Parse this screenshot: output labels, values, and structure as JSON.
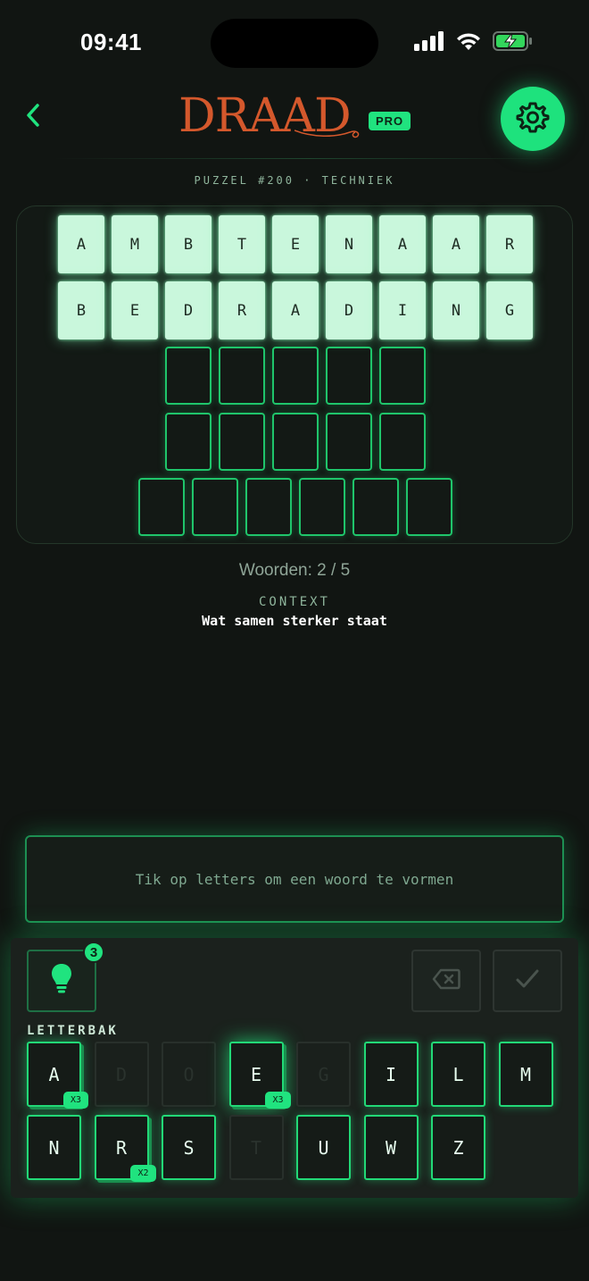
{
  "status": {
    "time": "09:41"
  },
  "header": {
    "logo": "DRAAD",
    "badge": "PRO"
  },
  "puzzle": {
    "label": "PUZZEL #200 · TECHNIEK"
  },
  "board": {
    "word1": [
      "A",
      "M",
      "B",
      "T",
      "E",
      "N",
      "A",
      "A",
      "R"
    ],
    "word2": [
      "B",
      "E",
      "D",
      "R",
      "A",
      "D",
      "I",
      "N",
      "G"
    ],
    "row3_length": 5,
    "row4_length": 5,
    "row5_length": 6
  },
  "progress": {
    "words": "Woorden: 2 / 5"
  },
  "context": {
    "label": "CONTEXT",
    "text": "Wat samen sterker staat"
  },
  "input": {
    "placeholder": "Tik op letters om een woord te vormen"
  },
  "panel": {
    "hint_count": "3",
    "letterbak_label": "LETTERBAK",
    "keys": [
      {
        "letter": "A",
        "mult": "X3",
        "used": false
      },
      {
        "letter": "D",
        "mult": "",
        "used": true
      },
      {
        "letter": "O",
        "mult": "",
        "used": true
      },
      {
        "letter": "E",
        "mult": "X3",
        "used": false
      },
      {
        "letter": "G",
        "mult": "",
        "used": true
      },
      {
        "letter": "I",
        "mult": "",
        "used": false
      },
      {
        "letter": "L",
        "mult": "",
        "used": false
      },
      {
        "letter": "M",
        "mult": "",
        "used": false
      },
      {
        "letter": "N",
        "mult": "",
        "used": false
      },
      {
        "letter": "R",
        "mult": "X2",
        "used": false
      },
      {
        "letter": "S",
        "mult": "",
        "used": false
      },
      {
        "letter": "T",
        "mult": "",
        "used": true
      },
      {
        "letter": "U",
        "mult": "",
        "used": false
      },
      {
        "letter": "W",
        "mult": "",
        "used": false
      },
      {
        "letter": "Z",
        "mult": "",
        "used": false
      }
    ]
  },
  "colors": {
    "accent": "#20e37f",
    "logo": "#d4582c",
    "background": "#111512"
  },
  "icons": [
    "back-chevron-icon",
    "gear-icon",
    "lightbulb-icon",
    "backspace-icon",
    "check-icon",
    "signal-icon",
    "wifi-icon",
    "battery-charging-icon"
  ]
}
